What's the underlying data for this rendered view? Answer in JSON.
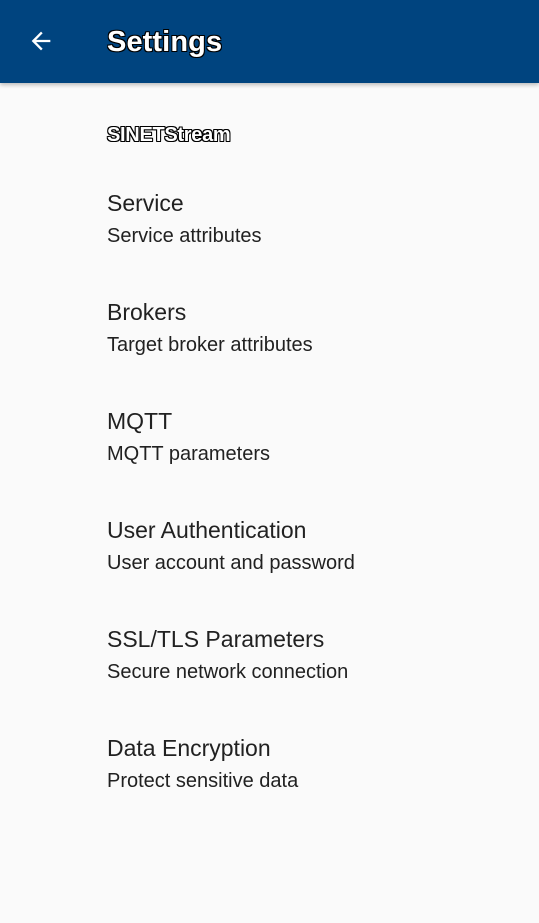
{
  "app_bar": {
    "title": "Settings",
    "back_icon": "arrow-back-icon",
    "background_color": "#00447f"
  },
  "category": {
    "title": "SINETStream"
  },
  "preferences": [
    {
      "title": "Service",
      "summary": "Service attributes"
    },
    {
      "title": "Brokers",
      "summary": "Target broker attributes"
    },
    {
      "title": "MQTT",
      "summary": "MQTT parameters"
    },
    {
      "title": "User Authentication",
      "summary": "User account and password"
    },
    {
      "title": "SSL/TLS Parameters",
      "summary": "Secure network connection"
    },
    {
      "title": "Data Encryption",
      "summary": "Protect sensitive data"
    }
  ]
}
